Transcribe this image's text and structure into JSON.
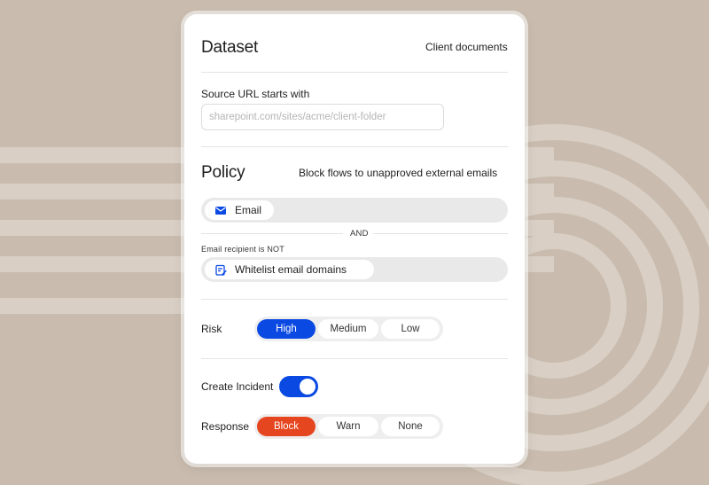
{
  "dataset": {
    "title": "Dataset",
    "name": "Client documents",
    "source_label": "Source URL starts with",
    "source_placeholder": "sharepoint.com/sites/acme/client-folder"
  },
  "policy": {
    "title": "Policy",
    "description": "Block flows to unapproved external emails",
    "channel_chip": "Email",
    "connector": "AND",
    "condition_label": "Email recipient is NOT",
    "condition_chip": "Whitelist email domains"
  },
  "risk": {
    "label": "Risk",
    "options": [
      "High",
      "Medium",
      "Low"
    ],
    "selected": "High"
  },
  "incident": {
    "label": "Create Incident",
    "enabled": true
  },
  "response": {
    "label": "Response",
    "options": [
      "Block",
      "Warn",
      "None"
    ],
    "selected": "Block"
  },
  "colors": {
    "background": "#c9bcae",
    "accent_blue": "#0a49e2",
    "accent_red": "#e5461f"
  },
  "icons": {
    "email_chip": "envelope-icon",
    "condition_chip": "clipboard-edit-icon"
  }
}
